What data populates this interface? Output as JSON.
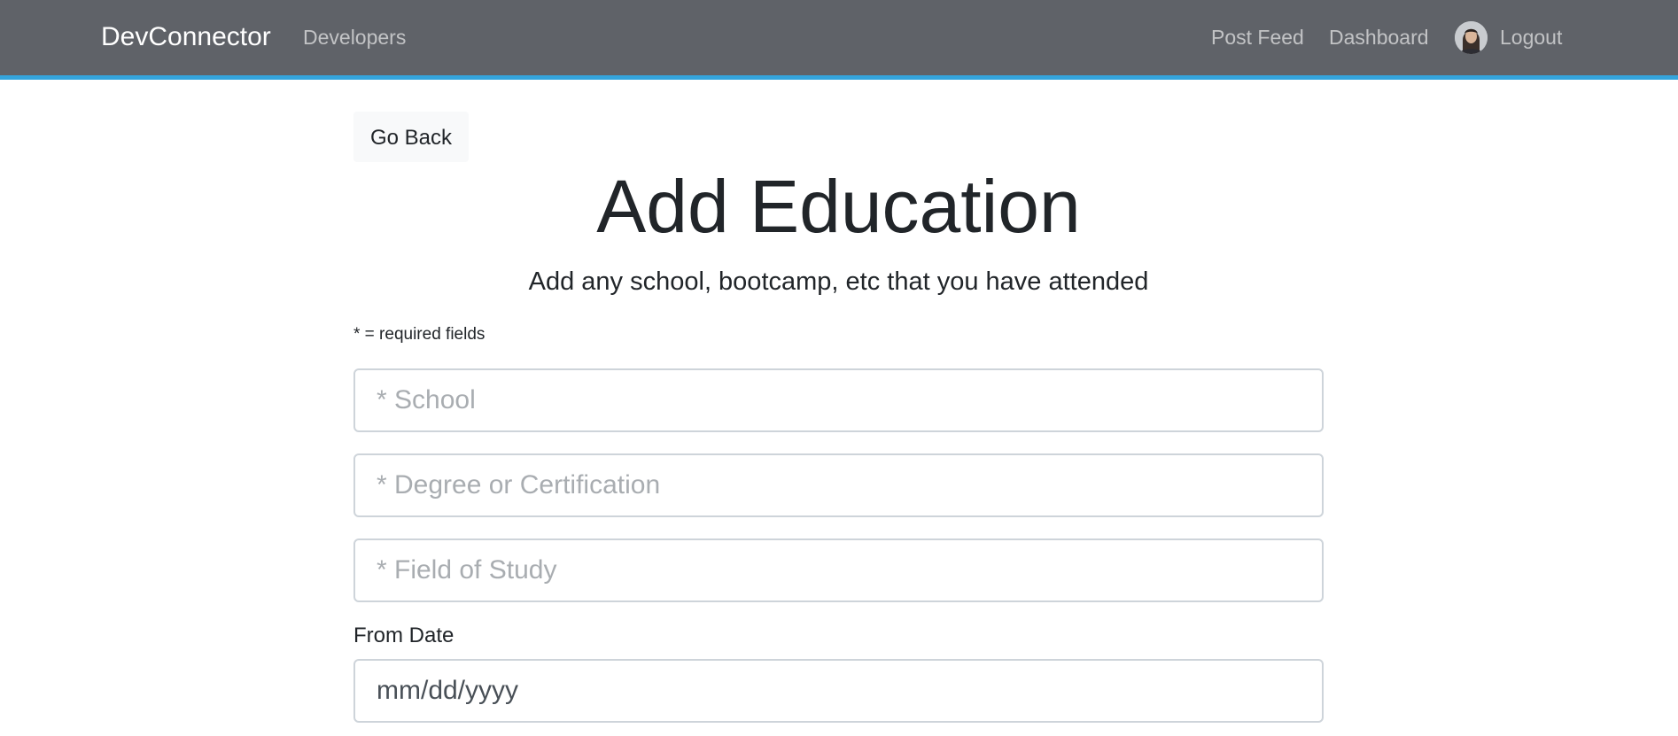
{
  "navbar": {
    "brand": "DevConnector",
    "left_links": [
      {
        "label": "Developers"
      }
    ],
    "right_links": [
      {
        "label": "Post Feed"
      },
      {
        "label": "Dashboard"
      }
    ],
    "logout_label": "Logout",
    "accent_color": "#34a4dc",
    "background_color": "#5f6268"
  },
  "page": {
    "go_back_label": "Go Back",
    "title": "Add Education",
    "lead": "Add any school, bootcamp, etc that you have attended",
    "required_note": "* = required fields"
  },
  "form": {
    "school": {
      "placeholder": "* School",
      "value": ""
    },
    "degree": {
      "placeholder": "* Degree or Certification",
      "value": ""
    },
    "field_of_study": {
      "placeholder": "* Field of Study",
      "value": ""
    },
    "from_date": {
      "label": "From Date",
      "placeholder": "mm/dd/yyyy",
      "value": ""
    }
  }
}
